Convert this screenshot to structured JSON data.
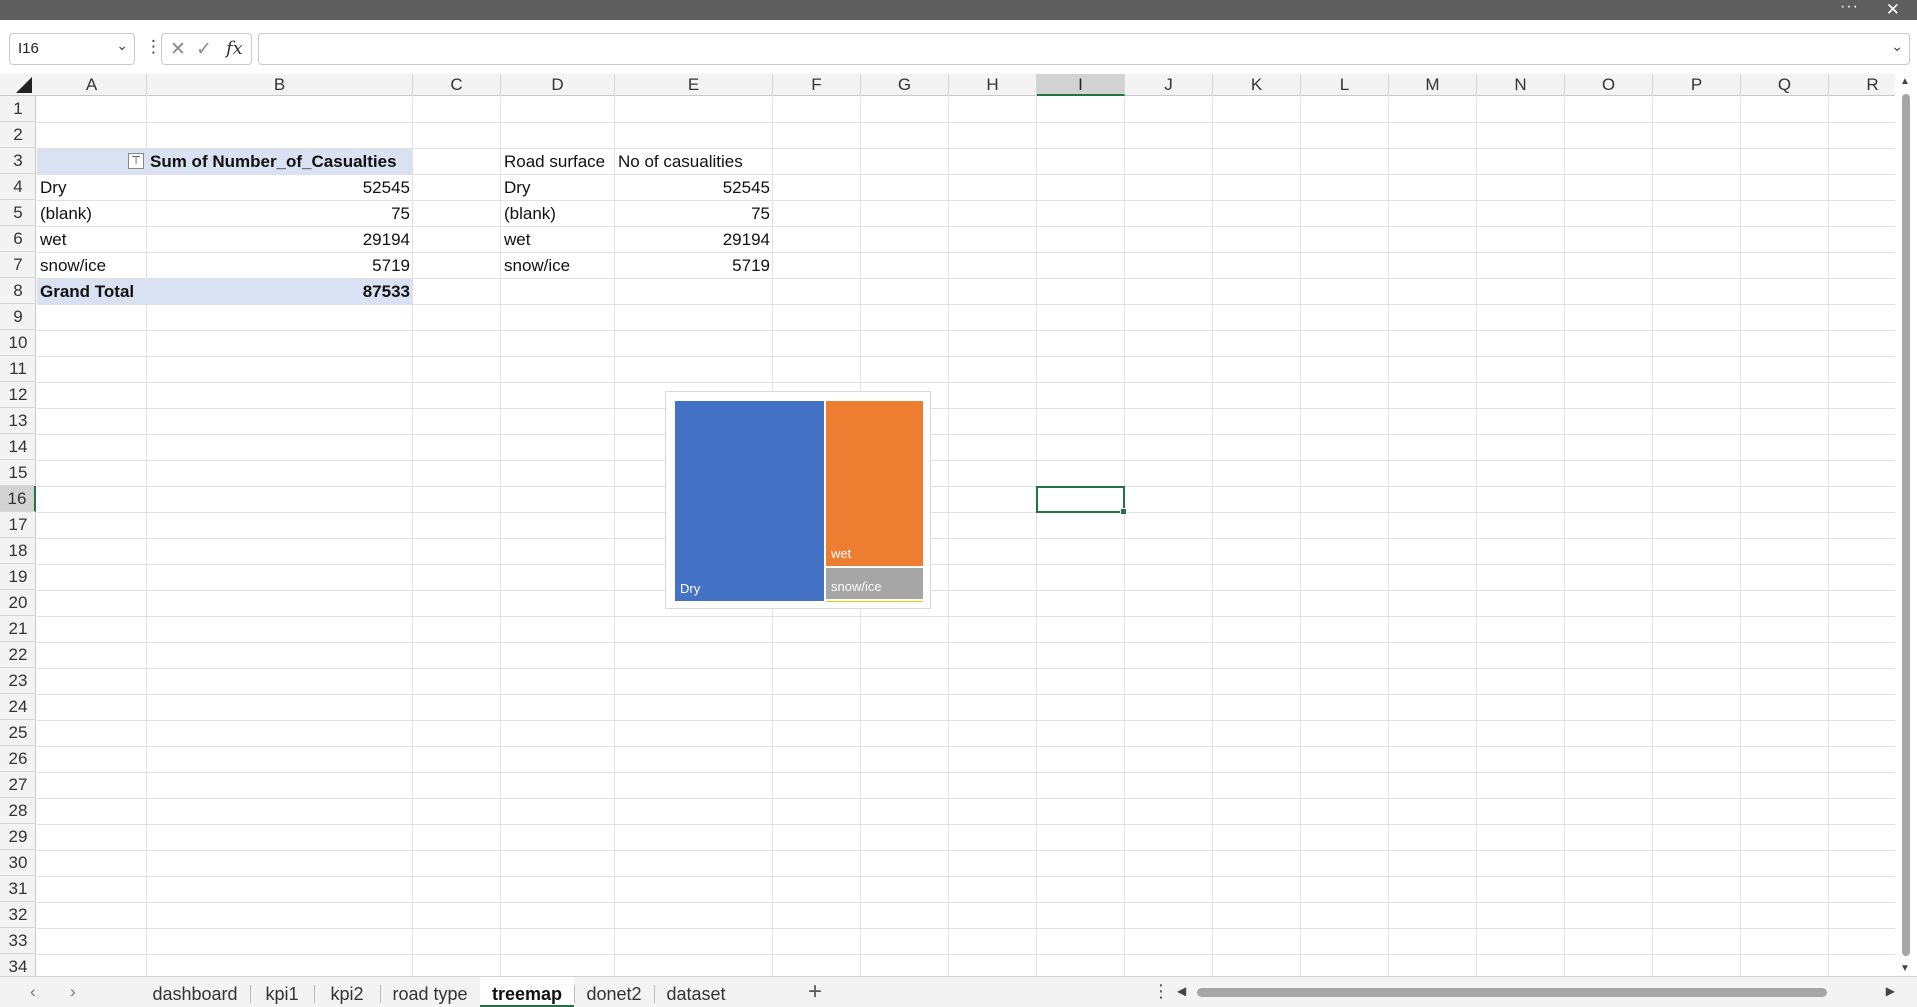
{
  "title_bar": {
    "more_icon": "more-horizontal-icon",
    "close_icon": "close-icon",
    "more_glyph": "···",
    "close_glyph": "✕"
  },
  "formula_bar": {
    "name_box": "I16",
    "cancel_glyph": "✕",
    "enter_glyph": "✓",
    "fx_label": "fx",
    "formula_value": ""
  },
  "columns": [
    "A",
    "B",
    "C",
    "D",
    "E",
    "F",
    "G",
    "H",
    "I",
    "J",
    "K",
    "L",
    "M",
    "N",
    "O",
    "P",
    "Q",
    "R"
  ],
  "selected_column": "I",
  "rows": [
    "1",
    "2",
    "3",
    "4",
    "5",
    "6",
    "7",
    "8",
    "9",
    "10",
    "11",
    "12",
    "13",
    "14",
    "15",
    "16",
    "17",
    "18",
    "19",
    "20",
    "21",
    "22",
    "23",
    "24",
    "25",
    "26",
    "27",
    "28",
    "29",
    "30",
    "31",
    "32",
    "33",
    "34"
  ],
  "selected_row": "16",
  "active_cell": "I16",
  "pivot_table": {
    "header_value": "Sum of Number_of_Casualties",
    "rows": [
      {
        "label": "Dry",
        "value": "52545"
      },
      {
        "label": "(blank)",
        "value": "75"
      },
      {
        "label": "wet",
        "value": "29194"
      },
      {
        "label": "snow/ice",
        "value": "5719"
      }
    ],
    "total_label": "Grand Total",
    "total_value": "87533",
    "header_fill": "#d9e1f2"
  },
  "data_table": {
    "header_col1": "Road surface",
    "header_col2": "No of casualities",
    "rows": [
      {
        "label": "Dry",
        "value": "52545"
      },
      {
        "label": "(blank)",
        "value": "75"
      },
      {
        "label": "wet",
        "value": "29194"
      },
      {
        "label": "snow/ice",
        "value": "5719"
      }
    ]
  },
  "chart_data": {
    "type": "treemap",
    "title": "",
    "categories": [
      "Dry",
      "wet",
      "snow/ice",
      "(blank)"
    ],
    "values": [
      52545,
      29194,
      5719,
      75
    ],
    "colors": [
      "#4472c4",
      "#ed7d31",
      "#a5a5a5",
      "#ffc000"
    ],
    "labels_shown": [
      "Dry",
      "wet",
      "snow/ice"
    ]
  },
  "sheet_tabs": [
    "dashboard",
    "kpi1",
    "kpi2",
    "road type",
    "treemap",
    "donet2",
    "dataset"
  ],
  "active_tab": "treemap",
  "add_sheet_glyph": "+",
  "tab_more_glyph": "⋮",
  "accent_color": "#217346"
}
